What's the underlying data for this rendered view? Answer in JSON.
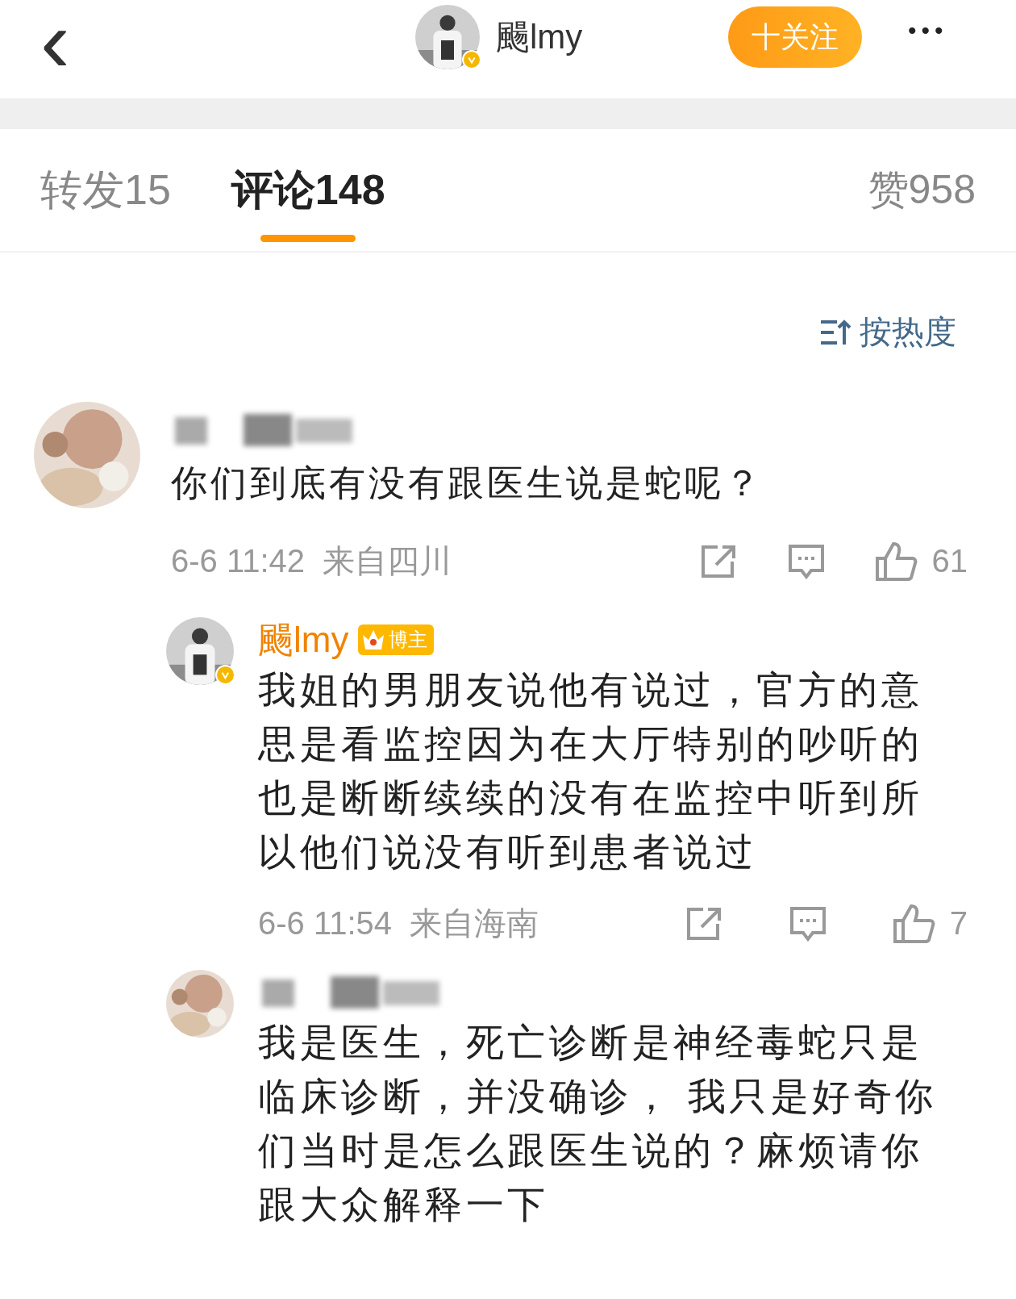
{
  "header": {
    "back": "‹",
    "username": "颺lmy",
    "verified": true,
    "follow_button": "十关注",
    "more": "•••"
  },
  "tabs": [
    {
      "label": "转发",
      "count": "15",
      "selected": false
    },
    {
      "label": "评论",
      "count": "148",
      "selected": true
    }
  ],
  "likes": {
    "label": "赞",
    "count": "958"
  },
  "sort": {
    "label": "按热度"
  },
  "comments": [
    {
      "author_hidden": true,
      "text": "你们到底有没有跟医生说是蛇呢？",
      "time": "6-6 11:42",
      "location": "来自四川",
      "like_count": "61",
      "replies": [
        {
          "author": "颺lmy",
          "author_hidden": false,
          "verified": true,
          "badge": "博主",
          "text": "我姐的男朋友说他有说过，官方的意思是看监控因为在大厅特别的吵听的也是断断续续的没有在监控中听到所以他们说没有听到患者说过",
          "time": "6-6 11:54",
          "location": "来自海南",
          "like_count": "7"
        },
        {
          "author_hidden": true,
          "text": "我是医生，死亡诊断是神经毒蛇只是临床诊断，并没确诊， 我只是好奇你们当时是怎么跟医生说的？麻烦请你跟大众解释一下"
        }
      ]
    }
  ]
}
